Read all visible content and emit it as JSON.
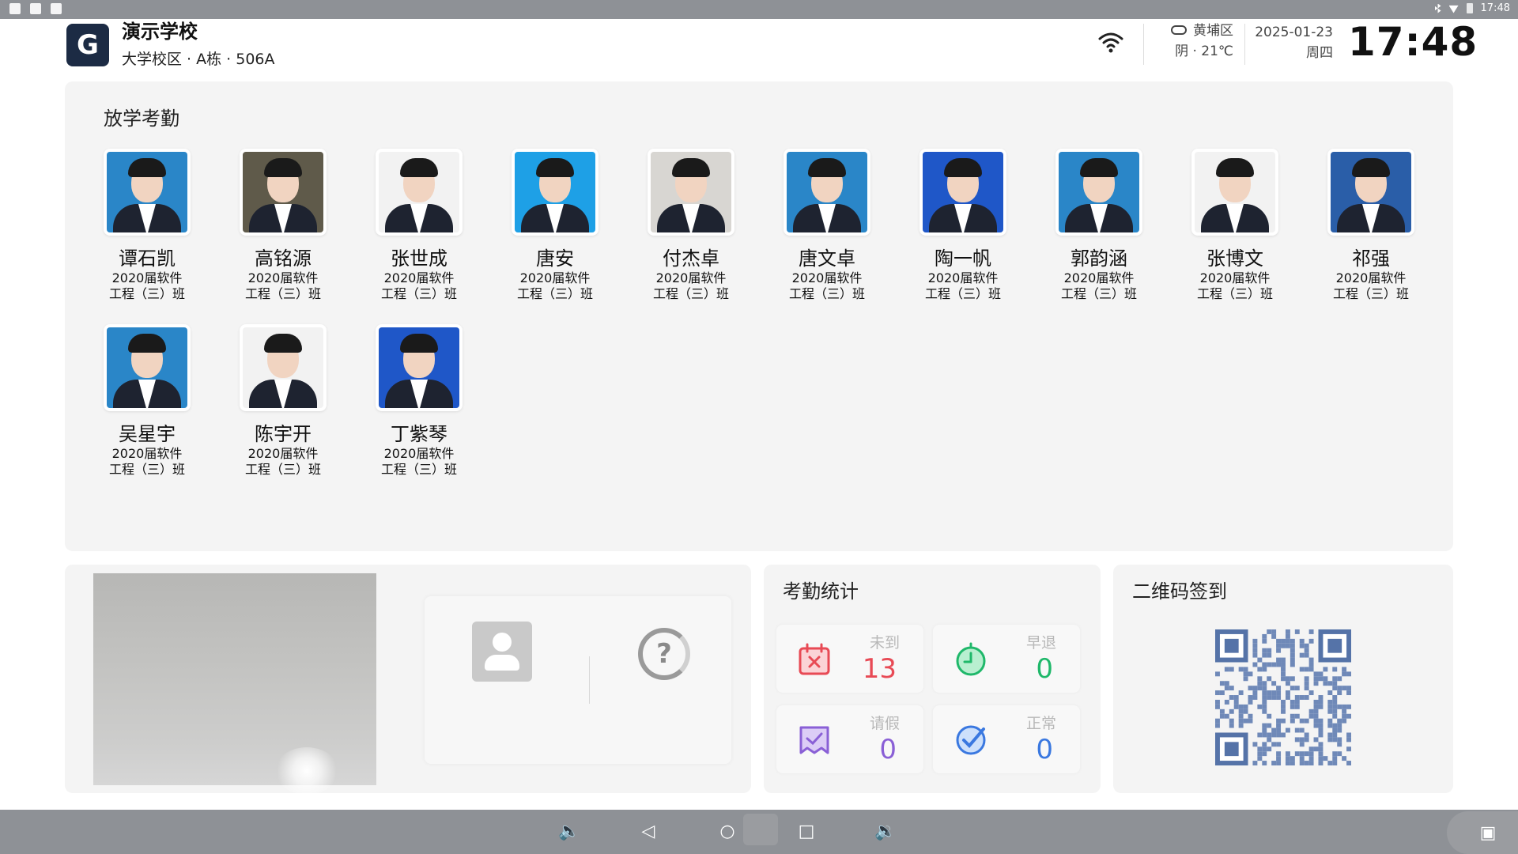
{
  "statusbar": {
    "time": "17:48"
  },
  "header": {
    "logo_letter": "G",
    "school_name": "演示学校",
    "location": "大学校区 · A栋 · 506A",
    "weather_district": "黄埔区",
    "weather_desc": "阴 · 21℃",
    "date": "2025-01-23",
    "weekday": "周四",
    "clock": "17:48"
  },
  "attendance": {
    "title": "放学考勤",
    "students": [
      {
        "name": "谭石凯",
        "class_line1": "2020届软件",
        "class_line2": "工程（三）班",
        "bg": "#2a86c8"
      },
      {
        "name": "高铭源",
        "class_line1": "2020届软件",
        "class_line2": "工程（三）班",
        "bg": "#5f5a4a"
      },
      {
        "name": "张世成",
        "class_line1": "2020届软件",
        "class_line2": "工程（三）班",
        "bg": "#f2f2f2"
      },
      {
        "name": "唐安",
        "class_line1": "2020届软件",
        "class_line2": "工程（三）班",
        "bg": "#1ea0e6"
      },
      {
        "name": "付杰卓",
        "class_line1": "2020届软件",
        "class_line2": "工程（三）班",
        "bg": "#d8d6d2"
      },
      {
        "name": "唐文卓",
        "class_line1": "2020届软件",
        "class_line2": "工程（三）班",
        "bg": "#2a86c8"
      },
      {
        "name": "陶一帆",
        "class_line1": "2020届软件",
        "class_line2": "工程（三）班",
        "bg": "#1f57c8"
      },
      {
        "name": "郭韵涵",
        "class_line1": "2020届软件",
        "class_line2": "工程（三）班",
        "bg": "#2a86c8"
      },
      {
        "name": "张博文",
        "class_line1": "2020届软件",
        "class_line2": "工程（三）班",
        "bg": "#f2f2f2"
      },
      {
        "name": "祁强",
        "class_line1": "2020届软件",
        "class_line2": "工程（三）班",
        "bg": "#2a5ea8"
      },
      {
        "name": "吴星宇",
        "class_line1": "2020届软件",
        "class_line2": "工程（三）班",
        "bg": "#2a86c8"
      },
      {
        "name": "陈宇开",
        "class_line1": "2020届软件",
        "class_line2": "工程（三）班",
        "bg": "#f2f2f2"
      },
      {
        "name": "丁紫琴",
        "class_line1": "2020届软件",
        "class_line2": "工程（三）班",
        "bg": "#1f57c8"
      }
    ]
  },
  "stats": {
    "title": "考勤统计",
    "items": [
      {
        "label": "未到",
        "value": "13",
        "color": "#e84a55",
        "icon": "calendar-x-icon"
      },
      {
        "label": "早退",
        "value": "0",
        "color": "#1fb86a",
        "icon": "clock-check-icon"
      },
      {
        "label": "请假",
        "value": "0",
        "color": "#8a60d6",
        "icon": "leave-note-icon"
      },
      {
        "label": "正常",
        "value": "0",
        "color": "#3a78e0",
        "icon": "check-circle-icon"
      }
    ]
  },
  "qr": {
    "title": "二维码签到"
  }
}
